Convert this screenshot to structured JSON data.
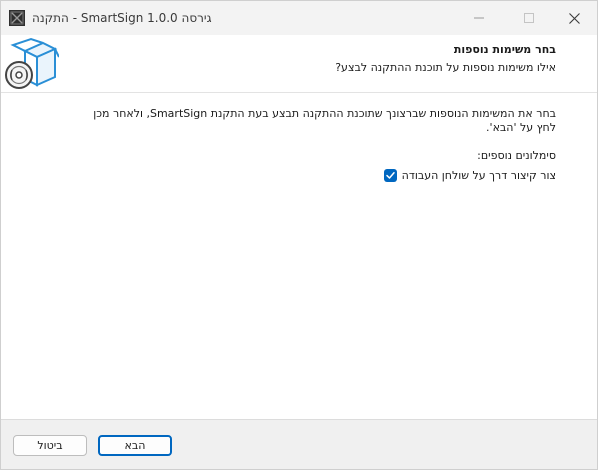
{
  "window": {
    "title": "התקנה - SmartSign גירסה 1.0.0"
  },
  "header": {
    "title": "בחר משימות נוספות",
    "subtitle": "אילו משימות נוספות על תוכנת ההתקנה לבצע?"
  },
  "content": {
    "description": "בחר את המשימות הנוספות שברצונך שתוכנת ההתקנה תבצע בעת התקנת SmartSign, ולאחר מכן לחץ על 'הבא'.",
    "group_label": "סימלונים נוספים:",
    "tasks": [
      {
        "label": "צור קיצור דרך על שולחן העבודה",
        "checked": true
      }
    ]
  },
  "footer": {
    "next_label": "הבא",
    "cancel_label": "ביטול"
  },
  "colors": {
    "accent": "#0067c0",
    "titlebar": "#f3f3f3",
    "footer": "#f0f0f0",
    "logo_blue": "#2a8fd6"
  },
  "icons": {
    "app": "smartsign-app-icon",
    "logo": "install-box-cd-icon",
    "minimize": "minimize-icon",
    "maximize": "maximize-icon",
    "close": "close-icon",
    "check": "checkmark-icon"
  }
}
